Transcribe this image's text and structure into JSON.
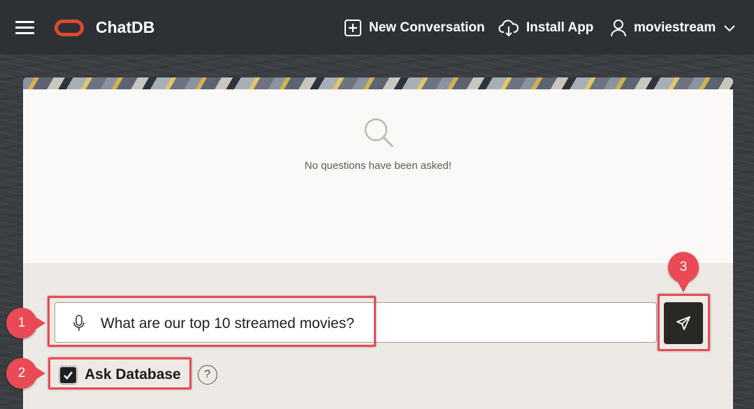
{
  "header": {
    "app_title": "ChatDB",
    "new_conversation_label": "New Conversation",
    "install_app_label": "Install App",
    "username": "moviestream",
    "brand_color": "#e0492b"
  },
  "main": {
    "empty_state_text": "No questions have been asked!",
    "prompt_value": "What are our top 10 streamed movies?",
    "ask_database_label": "Ask Database",
    "ask_database_checked": true,
    "help_glyph": "?"
  },
  "annotations": {
    "callout_1": "1",
    "callout_2": "2",
    "callout_3": "3",
    "color": "#e94a55"
  },
  "icons": [
    "menu-icon",
    "oracle-logo-icon",
    "plus-square-icon",
    "cloud-download-icon",
    "user-icon",
    "chevron-down-icon",
    "search-icon",
    "microphone-icon",
    "send-icon",
    "checkmark-icon",
    "help-icon"
  ]
}
